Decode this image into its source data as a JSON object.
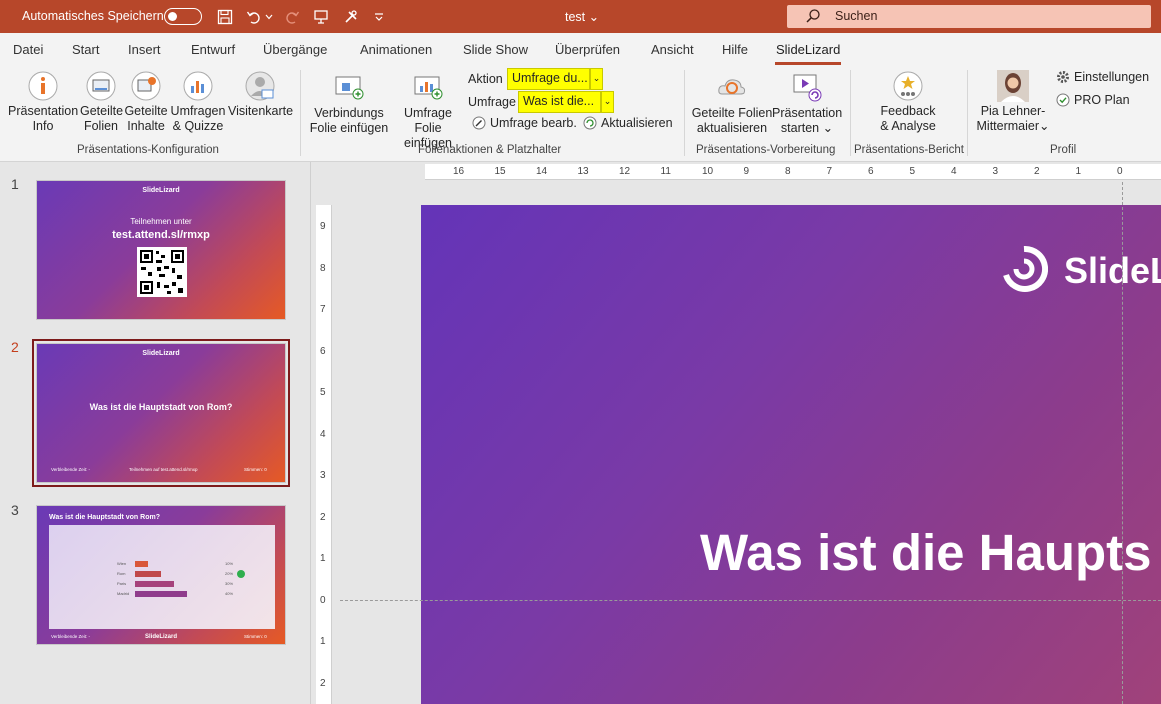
{
  "titlebar": {
    "autosave_label": "Automatisches Speichern",
    "doc_title": "test",
    "doc_title_chevron": "⌄",
    "search_placeholder": "Suchen"
  },
  "menu": {
    "tabs": [
      "Datei",
      "Start",
      "Insert",
      "Entwurf",
      "Übergänge",
      "Animationen",
      "Slide Show",
      "Überprüfen",
      "Ansicht",
      "Hilfe",
      "SlideLizard"
    ],
    "active": "SlideLizard"
  },
  "ribbon": {
    "praes_info": [
      "Präsentation",
      "Info"
    ],
    "geteilte_folien": [
      "Geteilte",
      "Folien"
    ],
    "geteilte_inhalte": [
      "Geteilte",
      "Inhalte"
    ],
    "umfragen": [
      "Umfragen",
      "& Quizze"
    ],
    "visitenkarte": "Visitenkarte",
    "group1": "Präsentations-Konfiguration",
    "verbindungs": [
      "Verbindungs",
      "Folie einfügen"
    ],
    "umfrage_folie": [
      "Umfrage Folie",
      "einfügen"
    ],
    "aktion_label": "Aktion",
    "aktion_value": "Umfrage du...",
    "umfrage_label": "Umfrage",
    "umfrage_value": "Was ist die...",
    "umfrage_bearb": "Umfrage bearb.",
    "aktualisieren": "Aktualisieren",
    "group2": "Folienaktionen & Platzhalter",
    "geteilte_akt": [
      "Geteilte Folien",
      "aktualisieren"
    ],
    "praes_starten": [
      "Präsentation",
      "starten"
    ],
    "group3": "Präsentations-Vorbereitung",
    "feedback": [
      "Feedback",
      "& Analyse"
    ],
    "group4": "Präsentations-Bericht",
    "user": [
      "Pia Lehner-",
      "Mittermaier"
    ],
    "einstellungen": "Einstellungen",
    "pro_plan": "PRO Plan",
    "group5": "Profil"
  },
  "slides": {
    "s1": {
      "num": "1",
      "logo": "SlideLizard",
      "line1": "Teilnehmen unter",
      "line2": "test.attend.sl/rmxp"
    },
    "s2": {
      "num": "2",
      "logo": "SlideLizard",
      "question": "Was ist die Hauptstadt von Rom?",
      "foot_left": "Verbleibende Zeit: -",
      "foot_mid": "Teilnehmen auf test.attend.sl/rmxp",
      "foot_right": "Stimmen:      0"
    },
    "s3": {
      "num": "3",
      "title": "Was ist die Hauptstadt von Rom?",
      "foot_left": "Verbleibende Zeit: -",
      "logo": "SlideLizard",
      "foot_right": "Stimmen:      0",
      "bars": [
        {
          "label": "Wien",
          "value": 10,
          "pct": "10%"
        },
        {
          "label": "Rom",
          "value": 20,
          "pct": "20%"
        },
        {
          "label": "Paris",
          "value": 30,
          "pct": "30%"
        },
        {
          "label": "Madrid",
          "value": 40,
          "pct": "40%"
        }
      ]
    }
  },
  "editor": {
    "slide_logo": "SlideL",
    "slide_question": "Was ist die Haupts",
    "hruler": [
      "16",
      "15",
      "14",
      "13",
      "12",
      "11",
      "10",
      "9",
      "8",
      "7",
      "6",
      "5",
      "4",
      "3",
      "2",
      "1",
      "0"
    ],
    "vruler": [
      "9",
      "8",
      "7",
      "6",
      "5",
      "4",
      "3",
      "2",
      "1",
      "0",
      "1",
      "2"
    ]
  }
}
